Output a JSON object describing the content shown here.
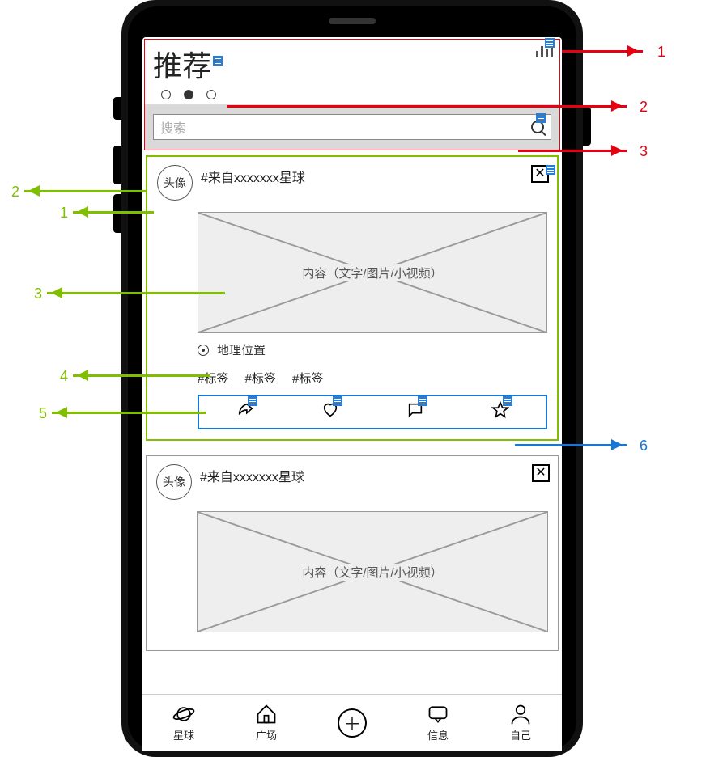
{
  "header": {
    "title": "推荐"
  },
  "search": {
    "placeholder": "搜索"
  },
  "feed": [
    {
      "avatar_label": "头像",
      "source_text": "#来自xxxxxxx星球",
      "content_label": "内容（文字/图片/小视频）",
      "geo_label": "地理位置",
      "tags": [
        "#标签",
        "#标签",
        "#标签"
      ],
      "highlight": true,
      "show_action_bar": true
    },
    {
      "avatar_label": "头像",
      "source_text": "#来自xxxxxxx星球",
      "content_label": "内容（文字/图片/小视频）",
      "highlight": false,
      "show_action_bar": false
    }
  ],
  "bottom_nav": {
    "star": "星球",
    "plaza": "广场",
    "message": "信息",
    "self": "自己"
  },
  "annotations": {
    "left": [
      {
        "n": "2",
        "color": "#7fbf00"
      },
      {
        "n": "1",
        "color": "#7fbf00"
      },
      {
        "n": "3",
        "color": "#7fbf00"
      },
      {
        "n": "4",
        "color": "#7fbf00"
      },
      {
        "n": "5",
        "color": "#7fbf00"
      }
    ],
    "right": [
      {
        "n": "1",
        "color": "#e60012"
      },
      {
        "n": "2",
        "color": "#e60012"
      },
      {
        "n": "3",
        "color": "#e60012"
      },
      {
        "n": "6",
        "color": "#1976d2"
      }
    ]
  }
}
